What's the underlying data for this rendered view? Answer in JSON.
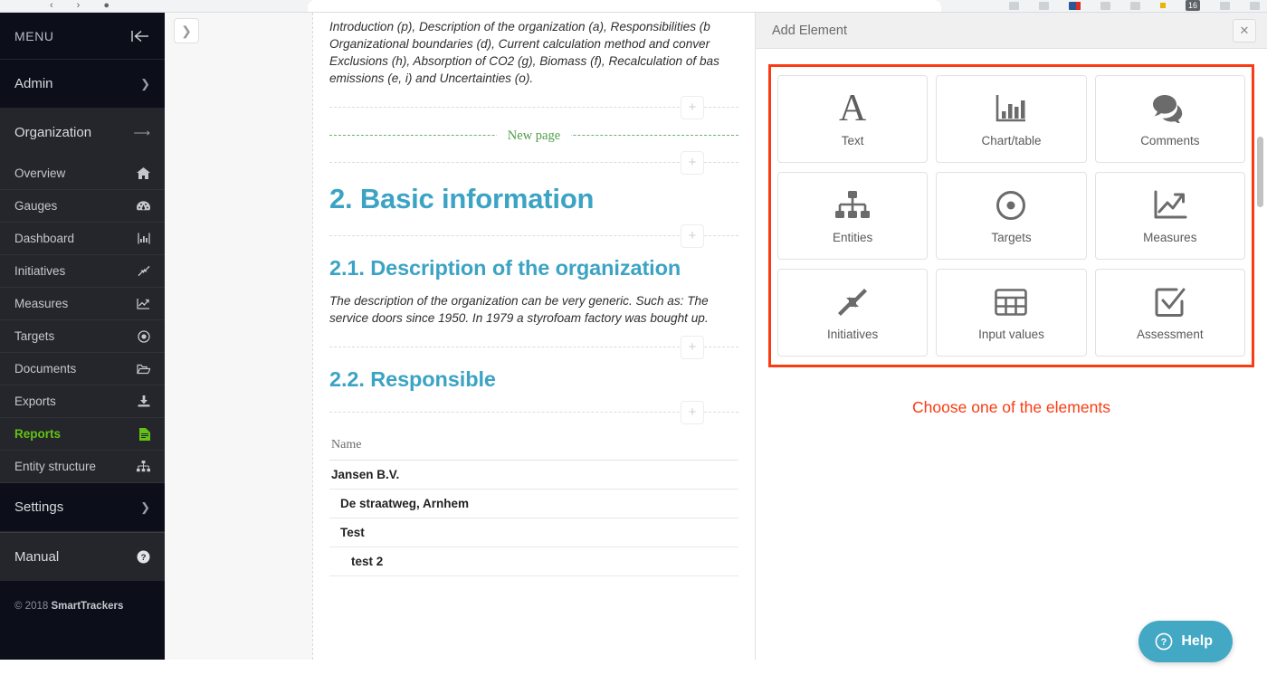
{
  "browser": {
    "tab_badge": "16"
  },
  "sidebar": {
    "menu_label": "MENU",
    "collapse_icon": "collapse-left-icon",
    "groups": [
      {
        "label": "Admin",
        "state": "collapsed"
      },
      {
        "label": "Organization",
        "state": "expanded"
      },
      {
        "label": "Settings",
        "state": "collapsed"
      }
    ],
    "items": [
      {
        "label": "Overview",
        "icon": "home-icon",
        "active": false
      },
      {
        "label": "Gauges",
        "icon": "gauge-icon",
        "active": false
      },
      {
        "label": "Dashboard",
        "icon": "bar-chart-icon",
        "active": false
      },
      {
        "label": "Initiatives",
        "icon": "compress-arrows-icon",
        "active": false
      },
      {
        "label": "Measures",
        "icon": "line-chart-icon",
        "active": false
      },
      {
        "label": "Targets",
        "icon": "bullseye-icon",
        "active": false
      },
      {
        "label": "Documents",
        "icon": "folder-open-icon",
        "active": false
      },
      {
        "label": "Exports",
        "icon": "download-icon",
        "active": false
      },
      {
        "label": "Reports",
        "icon": "file-document-icon",
        "active": true
      },
      {
        "label": "Entity structure",
        "icon": "sitemap-icon",
        "active": false
      }
    ],
    "manual": {
      "label": "Manual",
      "icon": "question-circle-icon"
    },
    "copyright_prefix": "© 2018 ",
    "copyright_brand": "SmartTrackers",
    "active_color": "#63c215"
  },
  "main": {
    "toggle_icon": "chevron-right-icon",
    "paragraph_lines": [
      "Introduction (p), Description of the organization (a), Responsibilities (b",
      "Organizational boundaries (d), Current calculation method and conver",
      "Exclusions (h), Absorption of CO2 (g), Biomass (f), Recalculation of bas",
      "emissions (e, i) and Uncertainties (o)."
    ],
    "add_icon": "plus-icon",
    "new_page_label": "New page",
    "new_page_color": "#4f9d4a",
    "heading_color": "#3ba3c4",
    "heading_1": "2. Basic information",
    "heading_2_1": "2.1. Description of the organization",
    "section_2_1_lines": [
      "The description of the organization can be very generic. Such as: The",
      "service doors since 1950. In 1979 a styrofoam factory was bought up. "
    ],
    "heading_2_2": "2.2. Responsible",
    "table": {
      "headers": [
        "Name"
      ],
      "rows": [
        {
          "name": "Jansen B.V.",
          "level": 0
        },
        {
          "name": "De straatweg, Arnhem",
          "level": 1
        },
        {
          "name": "Test",
          "level": 1
        },
        {
          "name": "test 2",
          "level": 2
        }
      ]
    }
  },
  "panel": {
    "title": "Add Element",
    "close_icon": "close-icon",
    "highlight_color": "#f93c13",
    "instruction": "Choose one of the elements",
    "elements": [
      {
        "label": "Text",
        "icon": "text-letter-a-icon"
      },
      {
        "label": "Chart/table",
        "icon": "bar-chart-icon"
      },
      {
        "label": "Comments",
        "icon": "comments-icon"
      },
      {
        "label": "Entities",
        "icon": "sitemap-icon"
      },
      {
        "label": "Targets",
        "icon": "bullseye-icon"
      },
      {
        "label": "Measures",
        "icon": "line-chart-up-icon"
      },
      {
        "label": "Initiatives",
        "icon": "compress-arrows-icon"
      },
      {
        "label": "Input values",
        "icon": "table-grid-icon"
      },
      {
        "label": "Assessment",
        "icon": "check-square-icon"
      }
    ]
  },
  "help": {
    "label": "Help",
    "icon": "question-circle-icon",
    "color": "#43a8c3"
  }
}
